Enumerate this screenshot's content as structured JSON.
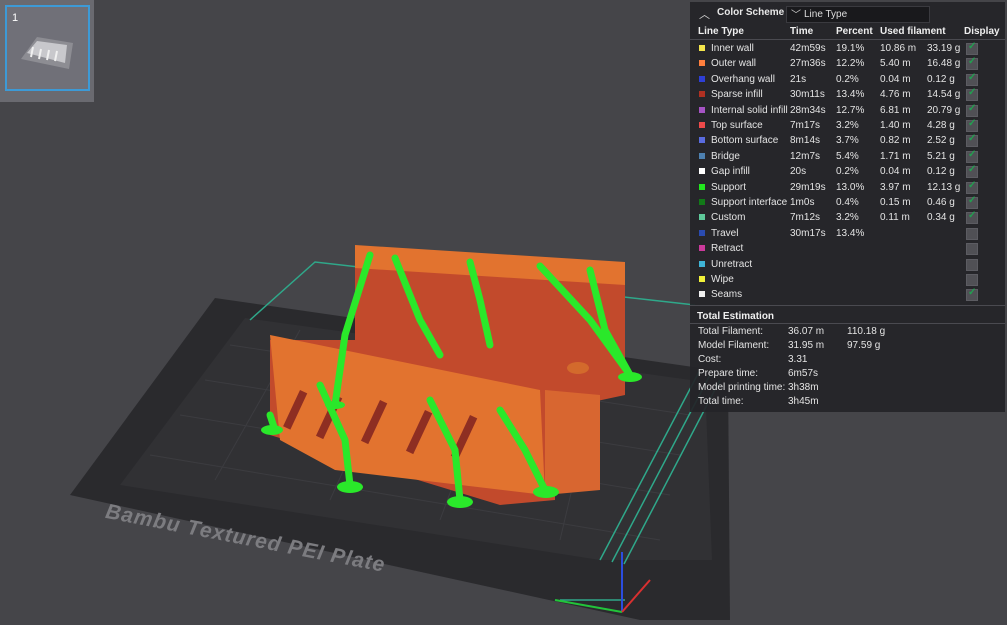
{
  "plate": {
    "thumbnail_number": "1",
    "label": "Bambu Textured PEI Plate"
  },
  "legend": {
    "color_scheme_label": "Color Scheme",
    "color_scheme_value": "Line Type",
    "headers": [
      "Line Type",
      "Time",
      "Percent",
      "Used filament",
      "Display"
    ],
    "rows": [
      {
        "name": "Inner wall",
        "color": "#f3e54c",
        "time": "42m59s",
        "percent": "19.1%",
        "length": "10.86 m",
        "weight": "33.19 g",
        "display": true
      },
      {
        "name": "Outer wall",
        "color": "#ff7f3e",
        "time": "27m36s",
        "percent": "12.2%",
        "length": "5.40 m",
        "weight": "16.48 g",
        "display": true
      },
      {
        "name": "Overhang wall",
        "color": "#2e3fd6",
        "time": "21s",
        "percent": "0.2%",
        "length": "0.04 m",
        "weight": "0.12 g",
        "display": true
      },
      {
        "name": "Sparse infill",
        "color": "#b03022",
        "time": "30m11s",
        "percent": "13.4%",
        "length": "4.76 m",
        "weight": "14.54 g",
        "display": true
      },
      {
        "name": "Internal solid infill",
        "color": "#a653c4",
        "time": "28m34s",
        "percent": "12.7%",
        "length": "6.81 m",
        "weight": "20.79 g",
        "display": true
      },
      {
        "name": "Top surface",
        "color": "#ee4a4a",
        "time": "7m17s",
        "percent": "3.2%",
        "length": "1.40 m",
        "weight": "4.28 g",
        "display": true
      },
      {
        "name": "Bottom surface",
        "color": "#5a6ce0",
        "time": "8m14s",
        "percent": "3.7%",
        "length": "0.82 m",
        "weight": "2.52 g",
        "display": true
      },
      {
        "name": "Bridge",
        "color": "#4d80b0",
        "time": "12m7s",
        "percent": "5.4%",
        "length": "1.71 m",
        "weight": "5.21 g",
        "display": true
      },
      {
        "name": "Gap infill",
        "color": "#ffffff",
        "time": "20s",
        "percent": "0.2%",
        "length": "0.04 m",
        "weight": "0.12 g",
        "display": true
      },
      {
        "name": "Support",
        "color": "#22e61e",
        "time": "29m19s",
        "percent": "13.0%",
        "length": "3.97 m",
        "weight": "12.13 g",
        "display": true
      },
      {
        "name": "Support interface",
        "color": "#127a18",
        "time": "1m0s",
        "percent": "0.4%",
        "length": "0.15 m",
        "weight": "0.46 g",
        "display": true
      },
      {
        "name": "Custom",
        "color": "#5ec99a",
        "time": "7m12s",
        "percent": "3.2%",
        "length": "0.11 m",
        "weight": "0.34 g",
        "display": true
      },
      {
        "name": "Travel",
        "color": "#2a4bb0",
        "time": "30m17s",
        "percent": "13.4%",
        "length": "",
        "weight": "",
        "display": false
      },
      {
        "name": "Retract",
        "color": "#cc3a9c",
        "time": "",
        "percent": "",
        "length": "",
        "weight": "",
        "display": false
      },
      {
        "name": "Unretract",
        "color": "#3fb4d6",
        "time": "",
        "percent": "",
        "length": "",
        "weight": "",
        "display": false
      },
      {
        "name": "Wipe",
        "color": "#f2f23a",
        "time": "",
        "percent": "",
        "length": "",
        "weight": "",
        "display": false
      },
      {
        "name": "Seams",
        "color": "#f0f0f0",
        "time": "",
        "percent": "",
        "length": "",
        "weight": "",
        "display": true
      }
    ]
  },
  "total_estimation": {
    "title": "Total Estimation",
    "rows": [
      {
        "label": "Total Filament:",
        "value1": "36.07 m",
        "value2": "110.18 g"
      },
      {
        "label": "Model Filament:",
        "value1": "31.95 m",
        "value2": "97.59 g"
      },
      {
        "label": "Cost:",
        "value1": "3.31",
        "value2": ""
      },
      {
        "label": "Prepare time:",
        "value1": "6m57s",
        "value2": ""
      },
      {
        "label": "Model printing time:",
        "value1": "3h38m",
        "value2": ""
      },
      {
        "label": "Total time:",
        "value1": "3h45m",
        "value2": ""
      }
    ]
  }
}
